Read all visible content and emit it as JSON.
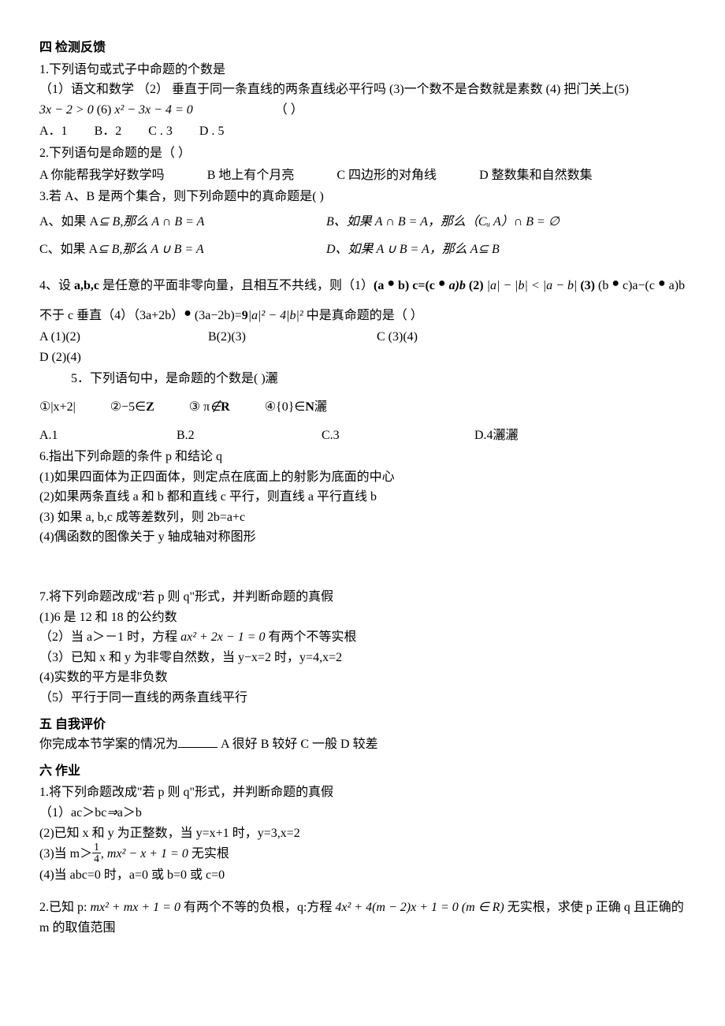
{
  "s4": {
    "title": "四 检测反馈",
    "q1": {
      "stem": "1.下列语句或式子中命题的个数是",
      "items": "（1）语文和数学 （2） 垂直于同一条直线的两条直线必平行吗   (3)一个数不是合数就是素数 (4) 把门关上(5)",
      "expr_a": "3x − 2 > 0",
      "mid": "(6)",
      "expr_b": "x² − 3x − 4 = 0",
      "paren": "（      ）",
      "opts": {
        "a": "A．1",
        "b": "B．2",
        "c": "C . 3",
        "d": "D . 5"
      }
    },
    "q2": {
      "stem": "2.下列语句是命题的是（     ）",
      "opts": {
        "a": "A 你能帮我学好数学吗",
        "b": "B 地上有个月亮",
        "c": "C 四边形的对角线",
        "d": "D 整数集和自然数集"
      }
    },
    "q3": {
      "stem": "3.若 A、B 是两个集合，则下列命题中的真命题是(        )",
      "a_pre": "A、如果 A",
      "a_sub": "⊆ B",
      "a_post": ",那么 A ∩ B = A",
      "b_pre": "B、如果 A ∩ B = A，那么（",
      "b_cu": "Cᵤ A",
      "b_post": "）∩ B = ∅",
      "c_pre": "C、如果 A",
      "c_sub": "⊆ B",
      "c_post": ",那么 A ∪ B = A",
      "d_pre": "D、如果 A ∪ B = A，那么 A",
      "d_sub": "⊆ B"
    },
    "q4": {
      "stem_a": "4、设 ",
      "bold1": "a,b,c",
      "stem_b": " 是任意的平面非零向量，且相互不共线，则（1）",
      "bold2": "(a ",
      "dot": "●",
      "bold3": " b) c=(c ",
      "bold4": " a)b",
      "bold5": " (2) ",
      "expr2": "|a| − |b| < |a − b|",
      "bold6": " (3) ",
      "p3": "(b ",
      "p3b": " c)a−(c ",
      "p3c": " a)b",
      "line2a": "不于 c 垂直（4）（3a+2b）",
      "line2b": " (3a−2b)=",
      "bold9": "9",
      "expr4": "|a|² − 4|b|²",
      "line2c": " 中是真命题的是（         ）",
      "opts": {
        "a": "A   (1)(2)",
        "b": "B(2)(3)",
        "c": "C (3)(4)",
        "d": "D (2)(4)"
      }
    },
    "q5": {
      "stem": "5．下列语句中，是命题的个数是(      )灑",
      "items": {
        "a": "①|x+2|",
        "b": "②−5∈",
        "b_bold": "Z",
        "c": "③ π",
        "c_sym": "∉",
        "c_bold": "R",
        "d": "④{0}∈",
        "d_bold": "N",
        "d_tail": "灑"
      },
      "opts": {
        "a": "A.1",
        "b": "B.2",
        "c": "C.3",
        "d": "D.4灑灑"
      }
    },
    "q6": {
      "stem": "6.指出下列命题的条件 p 和结论 q",
      "i1": "(1)如果四面体为正四面体，则定点在底面上的射影为底面的中心",
      "i2": "(2)如果两条直线 a 和 b 都和直线 c 平行，则直线 a 平行直线 b",
      "i3": "(3) 如果 a, b,c 成等差数列，则 2b=a+c",
      "i4": "(4)偶函数的图像关于 y 轴成轴对称图形"
    },
    "q7": {
      "stem": "7.将下列命题改成\"若 p 则 q\"形式，并判断命题的真假",
      "i1": "(1)6 是 12 和 18 的公约数",
      "i2a": "（2）当 a＞－1 时，方程 ",
      "i2expr": "ax² + 2x − 1 = 0",
      "i2b": " 有两个不等实根",
      "i3": "（3）已知 x 和 y 为非零自然数，当 y−x=2 时，y=4,x=2",
      "i4": "(4)实数的平方是非负数",
      "i5": "（5）平行于同一直线的两条直线平行"
    }
  },
  "s5": {
    "title": "五 自我评价",
    "text_a": "你完成本节学案的情况为",
    "text_b": "  A 很好   B 较好   C 一般   D 较差"
  },
  "s6": {
    "title": "六 作业",
    "q1": {
      "stem": "1.将下列命题改成\"若 p 则 q\"形式，并判断命题的真假",
      "i1a": "（1）ac＞bc",
      "i1arrow": "⇒",
      "i1b": "a＞b",
      "i2": "(2)已知 x 和 y 为正整数，当 y=x+1 时，y=3,x=2",
      "i3a": "(3)当 m＞",
      "i3frac_n": "1",
      "i3frac_d": "4",
      "i3b": ", ",
      "i3expr": "mx² − x + 1 = 0",
      "i3c": " 无实根",
      "i4": "(4)当 abc=0 时，a=0 或 b=0 或 c=0"
    },
    "q2": {
      "a": "2.已知 p: ",
      "expr1": "mx² + mx + 1 = 0",
      "b": " 有两个不等的负根，q:方程 ",
      "expr2": "4x² + 4(m − 2)x + 1 = 0 (m ∈ R)",
      "c": " 无实根，求使 p 正确 q 且正确的 m 的取值范围"
    }
  }
}
